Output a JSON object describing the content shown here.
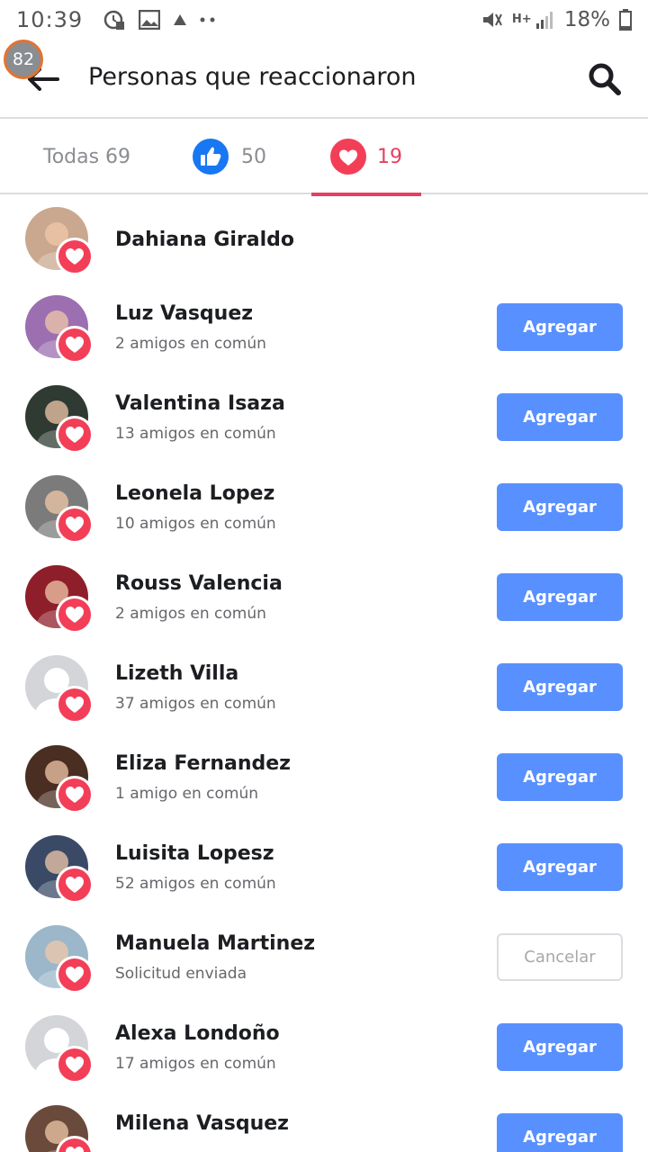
{
  "status_bar": {
    "time": "10:39",
    "battery_percent": "18%",
    "network": "H+",
    "icons": [
      "alarm-icon",
      "image-icon",
      "alert-icon",
      "more-dots-icon",
      "mute-icon",
      "signal-icon",
      "battery-icon"
    ]
  },
  "header": {
    "notification_count": "82",
    "title": "Personas que reaccionaron",
    "back_icon": "arrow-left-icon",
    "search_icon": "search-icon"
  },
  "tabs": {
    "all_label": "Todas 69",
    "like_count": "50",
    "love_count": "19",
    "selected": "love",
    "colors": {
      "love": "#e4405f",
      "like": "#1877f2"
    }
  },
  "people": [
    {
      "name": "Dahiana Giraldo",
      "mutual": "",
      "action": "",
      "avatar_color": "#c9a88f"
    },
    {
      "name": "Luz Vasquez",
      "mutual": "2 amigos en común",
      "action": "Agregar",
      "avatar_color": "#9b6fb0"
    },
    {
      "name": "Valentina Isaza",
      "mutual": "13 amigos en común",
      "action": "Agregar",
      "avatar_color": "#2f3b32"
    },
    {
      "name": "Leonela Lopez",
      "mutual": "10 amigos en común",
      "action": "Agregar",
      "avatar_color": "#7b7b7b"
    },
    {
      "name": "Rouss Valencia",
      "mutual": "2 amigos en común",
      "action": "Agregar",
      "avatar_color": "#8e1f2a"
    },
    {
      "name": "Lizeth Villa",
      "mutual": "37 amigos en común",
      "action": "Agregar",
      "avatar_color": "#d3d5d9"
    },
    {
      "name": "Eliza Fernandez",
      "mutual": "1 amigo en común",
      "action": "Agregar",
      "avatar_color": "#4a2e22"
    },
    {
      "name": "Luisita Lopesz",
      "mutual": "52 amigos en común",
      "action": "Agregar",
      "avatar_color": "#3a4a66"
    },
    {
      "name": "Manuela Martinez",
      "mutual": "Solicitud enviada",
      "action": "Cancelar",
      "avatar_color": "#9bb7c9"
    },
    {
      "name": "Alexa Londoño",
      "mutual": "17 amigos en común",
      "action": "Agregar",
      "avatar_color": "#d3d5d9"
    },
    {
      "name": "Milena Vasquez",
      "mutual": "",
      "action": "Agregar",
      "avatar_color": "#6a4a3a"
    }
  ],
  "colors": {
    "add_button": "#5890ff",
    "love_badge": "#f33e58"
  }
}
